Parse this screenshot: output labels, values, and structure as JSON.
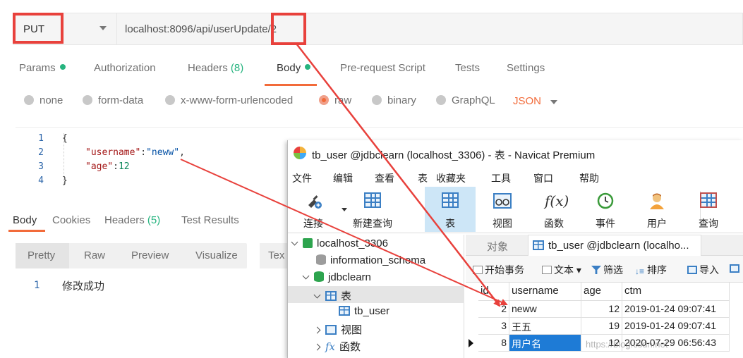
{
  "postman": {
    "method": "PUT",
    "url": "localhost:8096/api/userUpdate/2",
    "request_tabs": [
      {
        "label": "Params"
      },
      {
        "label": "Authorization"
      },
      {
        "label": "Headers",
        "count": "(8)"
      },
      {
        "label": "Body"
      },
      {
        "label": "Pre-request Script"
      },
      {
        "label": "Tests"
      },
      {
        "label": "Settings"
      }
    ],
    "body_types": [
      "none",
      "form-data",
      "x-www-form-urlencoded",
      "raw",
      "binary",
      "GraphQL"
    ],
    "selected_body_type": "raw",
    "format": "JSON",
    "editor": {
      "line_numbers": [
        "1",
        "2",
        "3",
        "4"
      ],
      "lines": {
        "open": "{",
        "key1": "\"username\"",
        "colon1": ":",
        "val1": "\"neww\"",
        "comma1": ",",
        "key2": "\"age\"",
        "colon2": ":",
        "val2": "12",
        "close": "}"
      }
    },
    "response_tabs": [
      {
        "label": "Body"
      },
      {
        "label": "Cookies"
      },
      {
        "label": "Headers",
        "count": "(5)"
      },
      {
        "label": "Test Results"
      }
    ],
    "view_modes": [
      "Pretty",
      "Raw",
      "Preview",
      "Visualize"
    ],
    "text_mode": "Tex",
    "response": {
      "line": "1",
      "text": "修改成功"
    }
  },
  "navicat": {
    "title": "tb_user @jdbclearn (localhost_3306) - 表 - Navicat Premium",
    "menu": [
      "文件",
      "编辑",
      "查看",
      "表",
      "收藏夹",
      "工具",
      "窗口",
      "帮助"
    ],
    "toolbar": [
      {
        "label": "连接",
        "icon": "plug-icon"
      },
      {
        "label": "新建查询",
        "icon": "new-query-icon"
      },
      {
        "label": "表",
        "icon": "table-icon"
      },
      {
        "label": "视图",
        "icon": "view-icon"
      },
      {
        "label": "函数",
        "icon": "function-icon"
      },
      {
        "label": "事件",
        "icon": "clock-icon"
      },
      {
        "label": "用户",
        "icon": "user-icon"
      },
      {
        "label": "查询",
        "icon": "query-icon"
      }
    ],
    "tree": {
      "connection": "localhost_3306",
      "db1": "information_schema",
      "db2": "jdbclearn",
      "tables_folder": "表",
      "table": "tb_user",
      "views_folder": "视图",
      "functions_folder": "函数"
    },
    "object_tabs": [
      "对象",
      "tb_user @jdbclearn (localho..."
    ],
    "actions": [
      "开始事务",
      "文本",
      "筛选",
      "排序",
      "导入"
    ],
    "grid": {
      "columns": [
        "id",
        "username",
        "age",
        "ctm"
      ],
      "rows": [
        {
          "id": "2",
          "username": "neww",
          "age": "12",
          "ctm": "2019-01-24 09:07:41"
        },
        {
          "id": "3",
          "username": "王五",
          "age": "19",
          "ctm": "2019-01-24 09:07:41"
        },
        {
          "id": "8",
          "username": "用户名",
          "age": "12",
          "ctm": "2020-07-29 06:56:43"
        }
      ]
    },
    "watermark": "https://blog.csdn.net"
  },
  "colors": {
    "annotation_red": "#e8413c",
    "postman_orange": "#f26b3a",
    "green": "#26b47f",
    "selection_blue": "#1e7bd6"
  }
}
